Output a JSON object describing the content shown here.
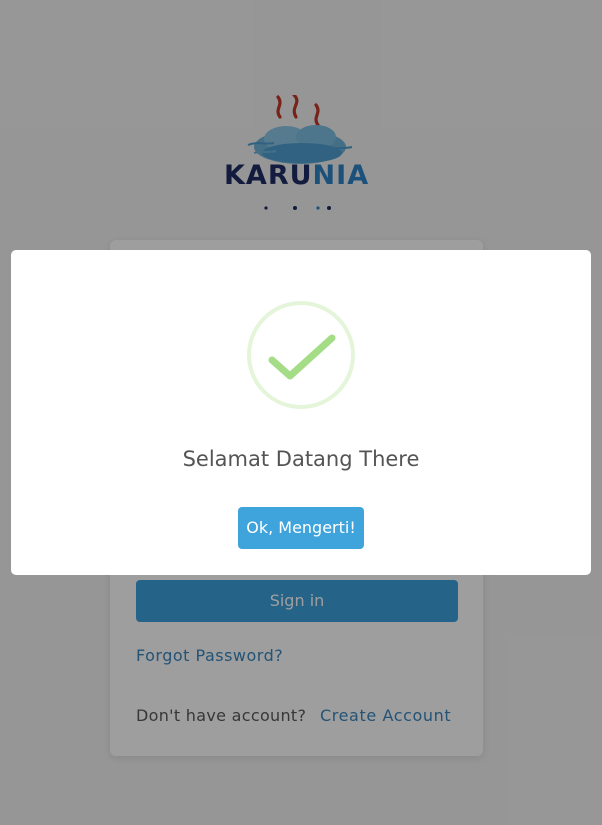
{
  "logo": {
    "name_main": "KARU",
    "name_accent": "NIA",
    "brand_dark": "#1f2d64",
    "brand_accent": "#2c84c6",
    "icon": "steaming-cloud-logo-icon"
  },
  "login": {
    "signin_label": "Sign in",
    "forgot_password_label": "Forgot Password?",
    "no_account_text": "Don't have account?",
    "create_account_label": "Create Account",
    "button_color": "#3da1dd",
    "link_color": "#3a86bd"
  },
  "modal": {
    "icon": "success-checkmark-icon",
    "title": "Selamat Datang There",
    "confirm_label": "Ok, Mengerti!",
    "confirm_color": "#3fa3dc",
    "success_color": "#a5dc86"
  }
}
